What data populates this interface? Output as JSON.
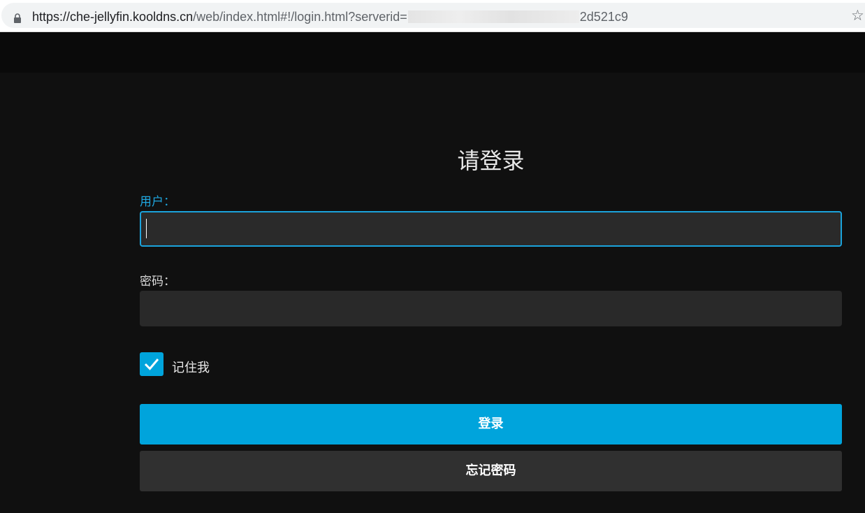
{
  "browser": {
    "url_host": "https://che-jellyfin.kooldns.cn",
    "url_path": "/web/index.html#!/login.html?serverid=",
    "url_tail": "2d521c9"
  },
  "login": {
    "title": "请登录",
    "username_label": "用户：",
    "username_value": "",
    "password_label": "密码：",
    "password_value": "",
    "remember_label": "记住我",
    "remember_checked": true,
    "submit_label": "登录",
    "forgot_label": "忘记密码"
  },
  "colors": {
    "accent": "#00a4dc",
    "background": "#101010",
    "field": "#292929",
    "secondary_button": "#303030"
  }
}
